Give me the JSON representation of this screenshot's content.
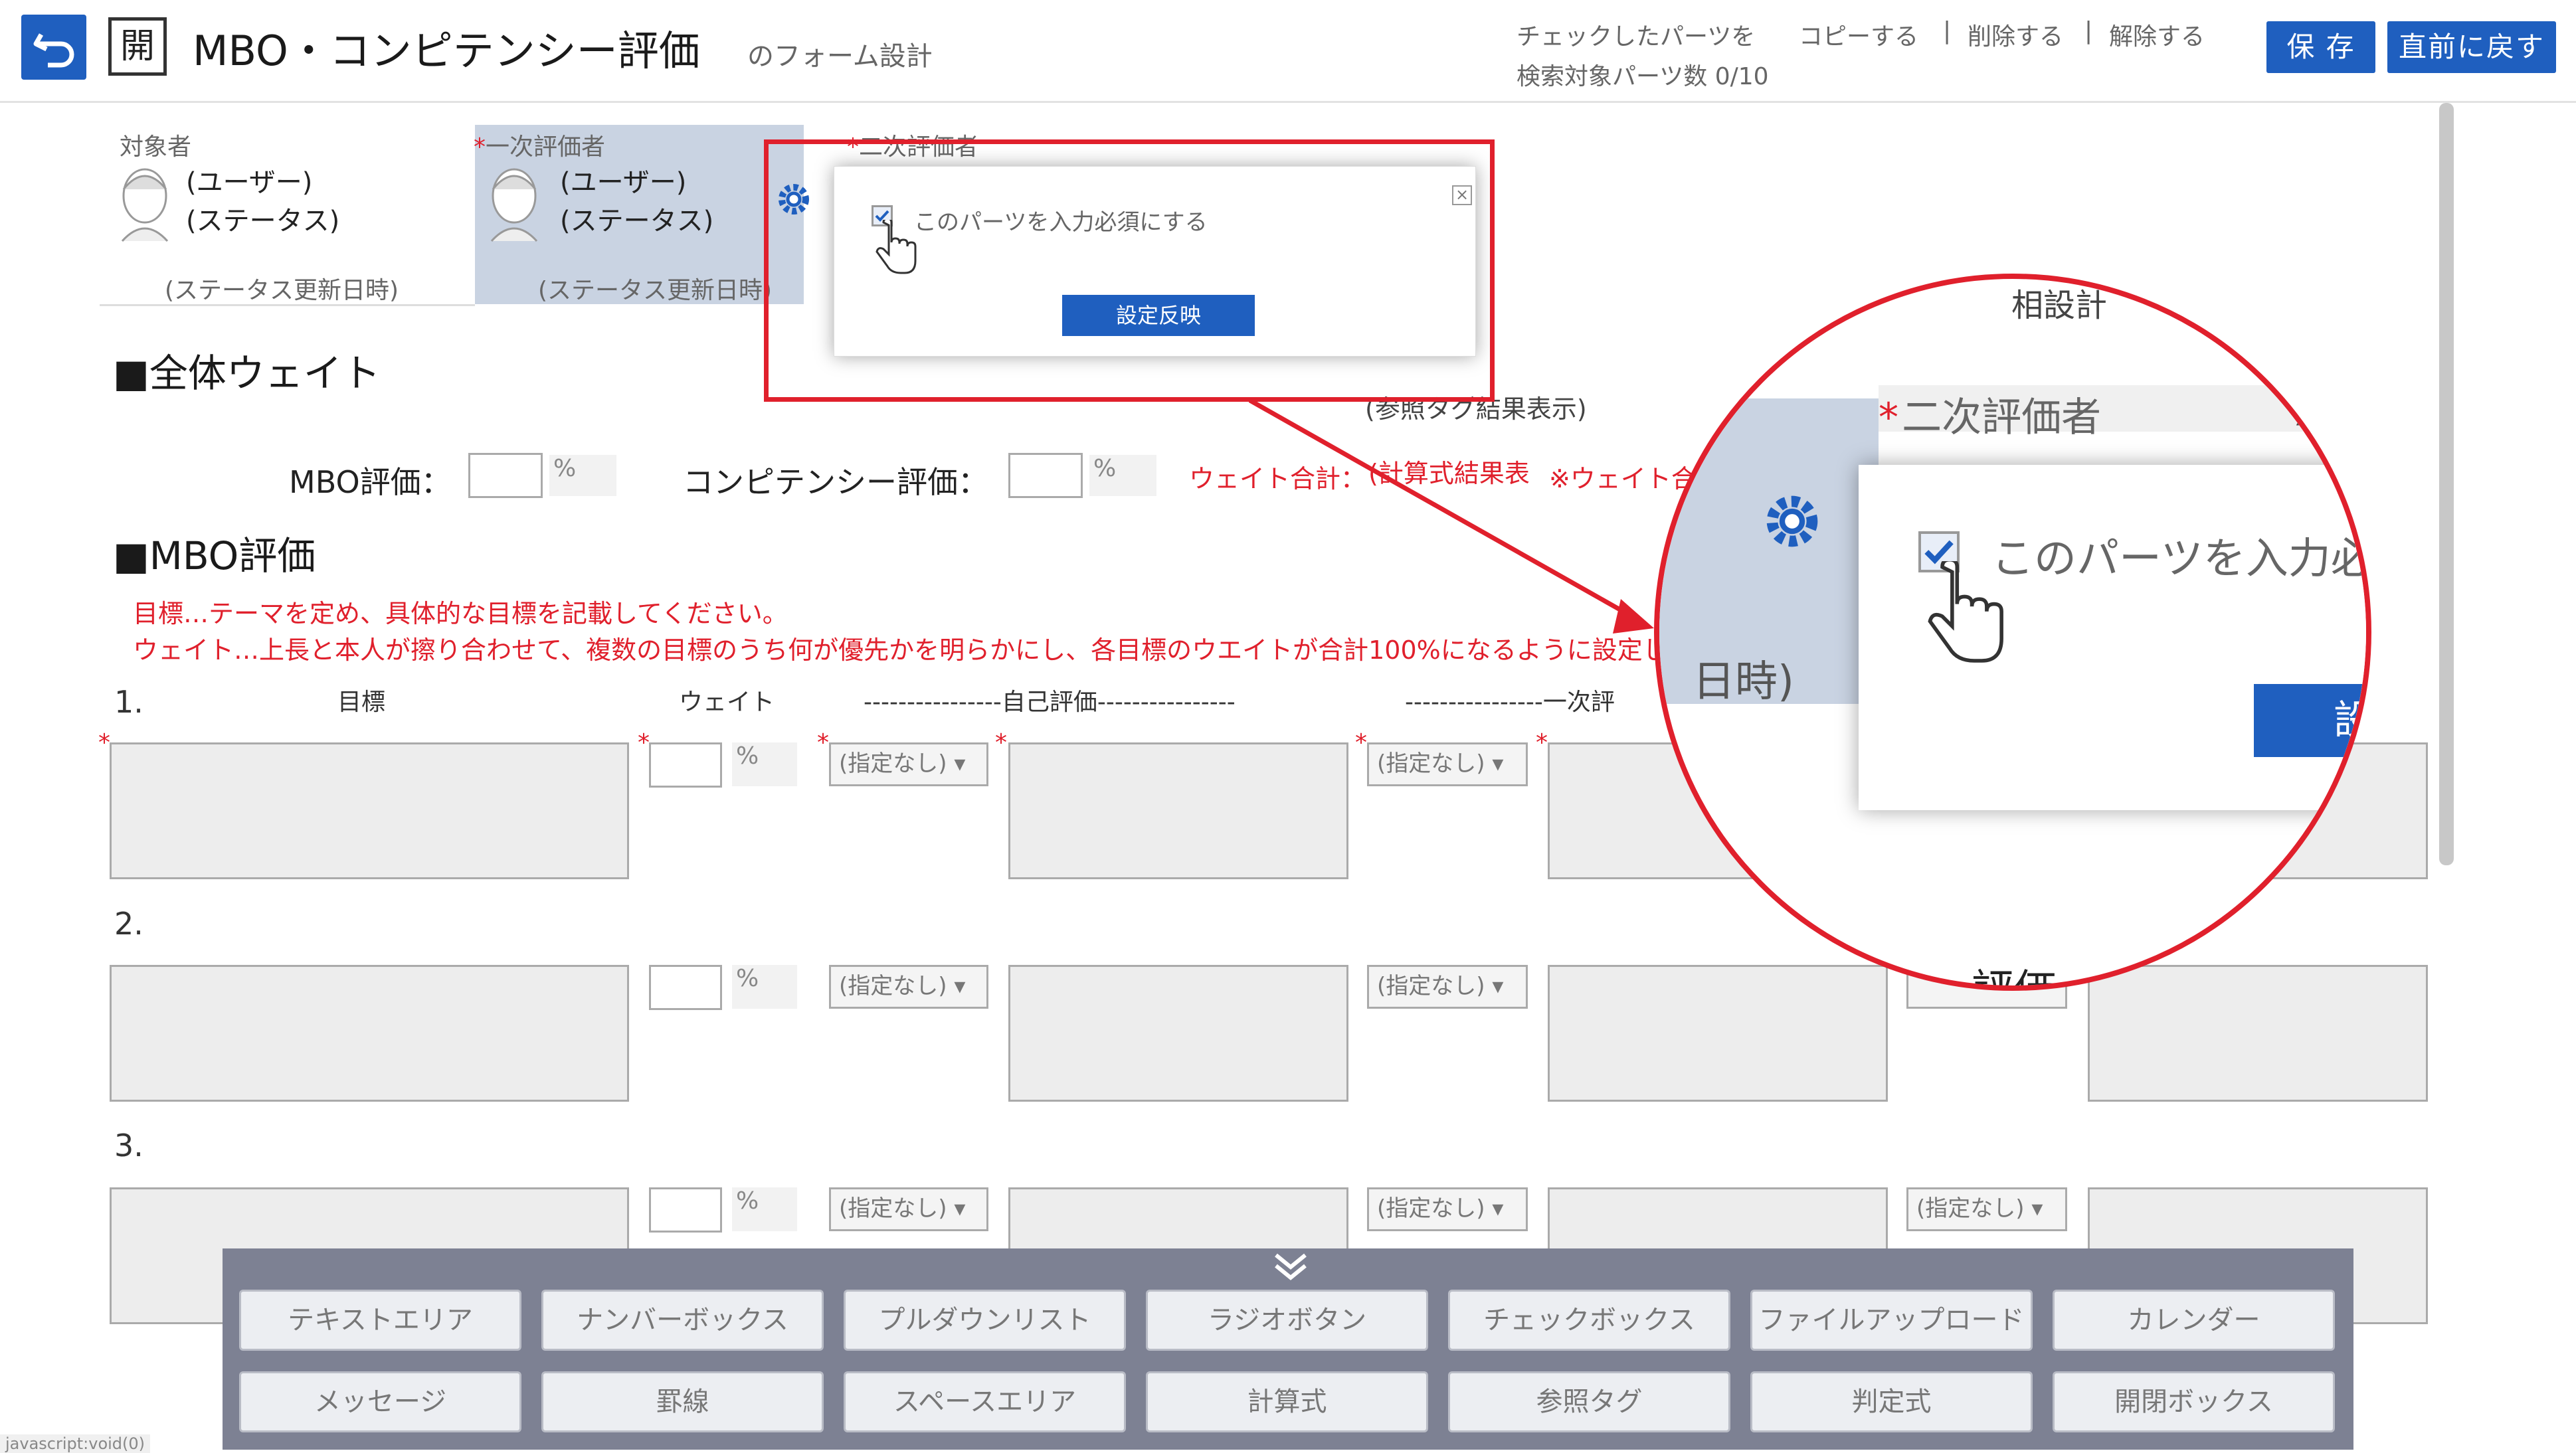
{
  "header": {
    "open_label": "開",
    "title": "MBO・コンピテンシー評価",
    "subtitle": "のフォーム設計",
    "checked_parts_label": "チェックしたパーツを",
    "copy_link": "コピーする",
    "delete_link": "削除する",
    "release_link": "解除する",
    "separator": "|",
    "search_count": "検索対象パーツ数 0/10",
    "save_label": "保 存",
    "revert_label": "直前に戻す"
  },
  "evaluators": {
    "target_label": "対象者",
    "first_label": "一次評価者",
    "second_label": "二次評価者",
    "required_mark": "*",
    "user": "(ユーザー)",
    "status": "(ステータス)",
    "status_date": "(ステータス更新日時)"
  },
  "popup": {
    "checkbox_label": "このパーツを入力必須にする",
    "apply_button": "設定反映",
    "close_icon": "close-icon"
  },
  "weight_section": {
    "heading": "■全体ウェイト",
    "mbo_label": "MBO評価：",
    "comp_label": "コンピテンシー評価：",
    "percent": "%",
    "total_label": "ウェイト合計：",
    "total_value": "(計算式結果表",
    "note": "※ウェイト合",
    "ref_tag": "(参照タグ結果表示)"
  },
  "mbo_section": {
    "heading": "■MBO評価",
    "instruction1": "目標…テーマを定め、具体的な目標を記載してください。",
    "instruction2": "ウェイト…上長と本人が擦り合わせて、複数の目標のうち何が優先かを明らかにし、各目標のウエイトが合計100%になるように設定し",
    "col_goal": "目標",
    "col_weight": "ウェイト",
    "col_self": "----------------自己評価----------------",
    "col_first": "----------------一次評",
    "col_tail": "---",
    "select_default": "(指定なし)",
    "rows": [
      "1.",
      "2.",
      "3."
    ],
    "eval_partial": "評価"
  },
  "zoom": {
    "second_label": "二次評価者",
    "checkbox_label": "このパーツを入力必",
    "date_fragment": "日時)",
    "button_fragment": "設",
    "top_fragment": "相設計",
    "paren": ")"
  },
  "palette": {
    "collapse_icon": "double-chevron-down-icon",
    "row1": [
      "テキストエリア",
      "ナンバーボックス",
      "プルダウンリスト",
      "ラジオボタン",
      "チェックボックス",
      "ファイルアップロード",
      "カレンダー"
    ],
    "row2": [
      "メッセージ",
      "罫線",
      "スペースエリア",
      "計算式",
      "参照タグ",
      "判定式",
      "開閉ボックス"
    ]
  },
  "statusbar": "javascript:void(0)",
  "colors": {
    "accent": "#1f5fbf",
    "highlight": "#e0202c",
    "palette": "#7d8193"
  }
}
